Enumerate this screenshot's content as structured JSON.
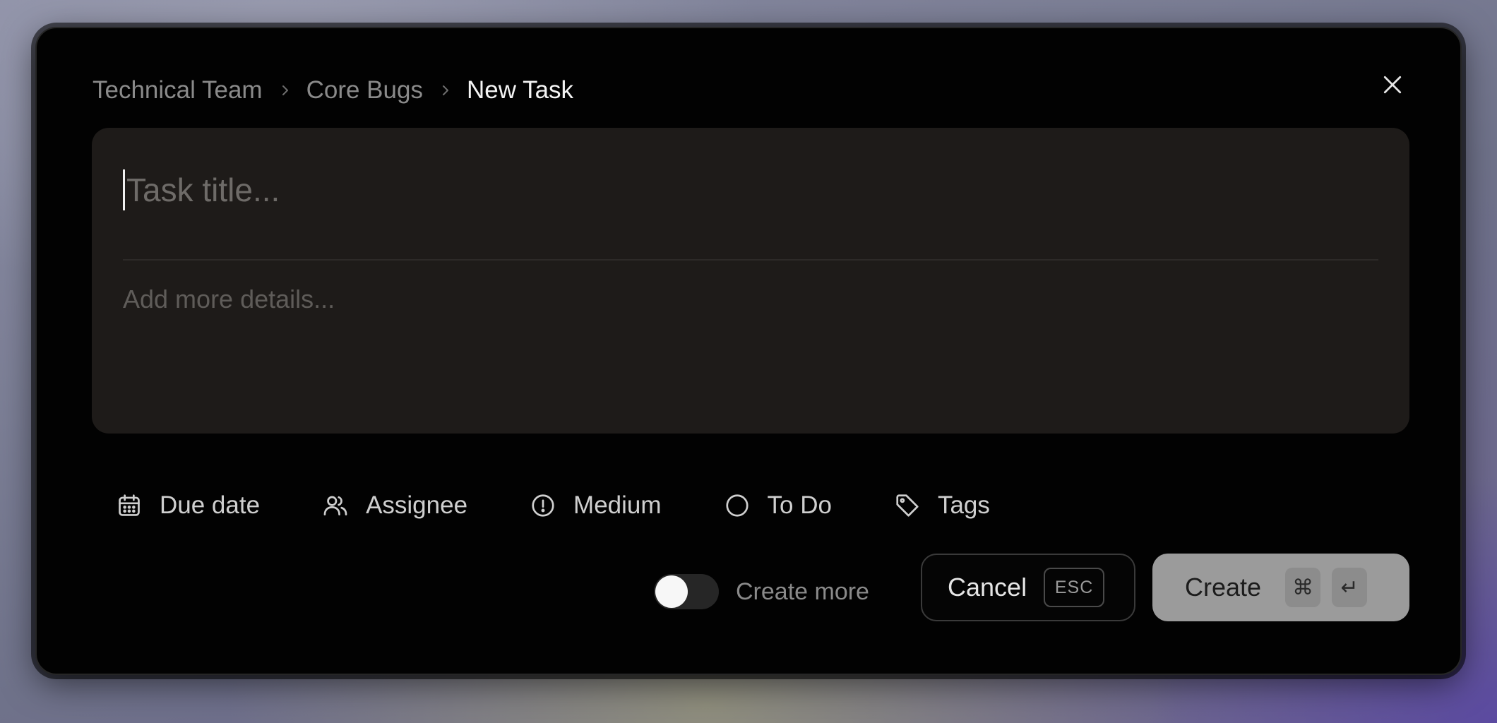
{
  "breadcrumb": {
    "items": [
      "Technical Team",
      "Core Bugs"
    ],
    "current": "New Task"
  },
  "editor": {
    "title_placeholder": "Task title...",
    "details_placeholder": "Add more details..."
  },
  "properties": [
    {
      "label": "Due date",
      "icon": "calendar-icon"
    },
    {
      "label": "Assignee",
      "icon": "users-icon"
    },
    {
      "label": "Medium",
      "icon": "alert-circle-icon"
    },
    {
      "label": "To Do",
      "icon": "circle-icon"
    },
    {
      "label": "Tags",
      "icon": "tag-icon"
    }
  ],
  "footer": {
    "create_more_label": "Create more",
    "create_more_enabled": false,
    "cancel_label": "Cancel",
    "cancel_shortcut": "ESC",
    "create_label": "Create",
    "create_shortcut": [
      "⌘",
      "↵"
    ]
  },
  "colors": {
    "modal_bg": "#020202",
    "editor_bg": "#1e1b19",
    "create_button_bg": "#9b9b9b",
    "muted_text": "#8a8a8a"
  }
}
